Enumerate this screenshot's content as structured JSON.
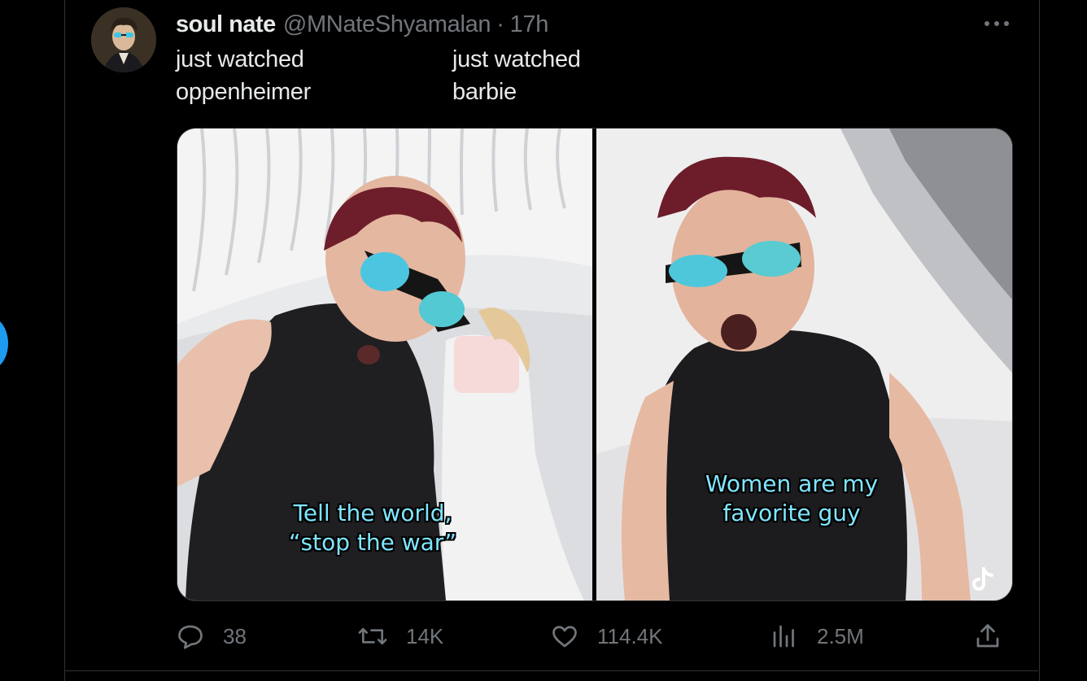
{
  "tweet": {
    "author": {
      "display_name": "soul nate",
      "handle": "@MNateShyamalan",
      "separator": "·",
      "time": "17h"
    },
    "text_columns": [
      {
        "line1": "just watched",
        "line2": "oppenheimer"
      },
      {
        "line1": "just watched",
        "line2": "barbie"
      }
    ],
    "media": {
      "captions": [
        {
          "line1": "Tell the world,",
          "line2": "“stop the war”"
        },
        {
          "line1": "Women are my",
          "line2": "favorite guy"
        }
      ],
      "watermark_icon": "tiktok-icon"
    },
    "actions": {
      "replies": "38",
      "reposts": "14K",
      "likes": "114.4K",
      "views": "2.5M"
    },
    "icons": [
      "more-icon",
      "reply-icon",
      "repost-icon",
      "like-icon",
      "views-icon",
      "share-icon"
    ]
  },
  "colors": {
    "background": "#000000",
    "text_primary": "#e7e9ea",
    "text_secondary": "#71767b",
    "border": "#2f3336",
    "caption": "#7fe6ff",
    "accent": "#1d9bf0"
  }
}
